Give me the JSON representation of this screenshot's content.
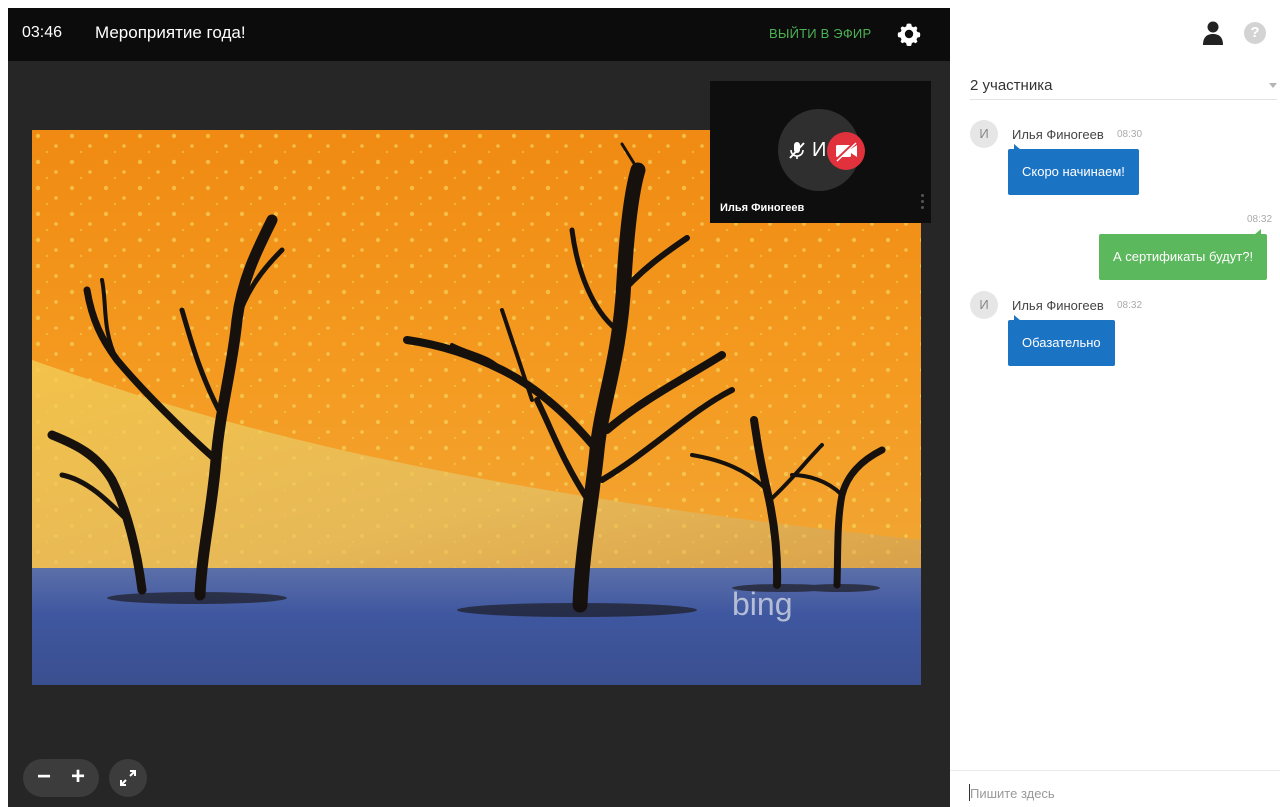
{
  "header": {
    "timer": "03:46",
    "title": "Мероприятие года!",
    "go_live_label": "ВЫЙТИ В ЭФИР"
  },
  "video": {
    "watermark": "bing"
  },
  "self_view": {
    "initial": "И",
    "name": "Илья Финогеев"
  },
  "controls": {
    "zoom_out_label": "−",
    "zoom_in_label": "+"
  },
  "sidebar": {
    "participants_label": "2 участника",
    "help_label": "?"
  },
  "chat": {
    "messages": [
      {
        "avatar": "И",
        "author": "Илья Финогеев",
        "time": "08:30",
        "text": "Скоро начинаем!",
        "direction": "in"
      },
      {
        "time": "08:32",
        "text": "А сертификаты будут?!",
        "direction": "out"
      },
      {
        "avatar": "И",
        "author": "Илья Финогеев",
        "time": "08:32",
        "text": "Обазательно",
        "direction": "in"
      }
    ],
    "input_placeholder": "Пишите здесь"
  },
  "colors": {
    "accent_green": "#4cb152",
    "bubble_in": "#1b73c4",
    "bubble_out": "#5cb85c",
    "cam_off_red": "#e0313d"
  }
}
